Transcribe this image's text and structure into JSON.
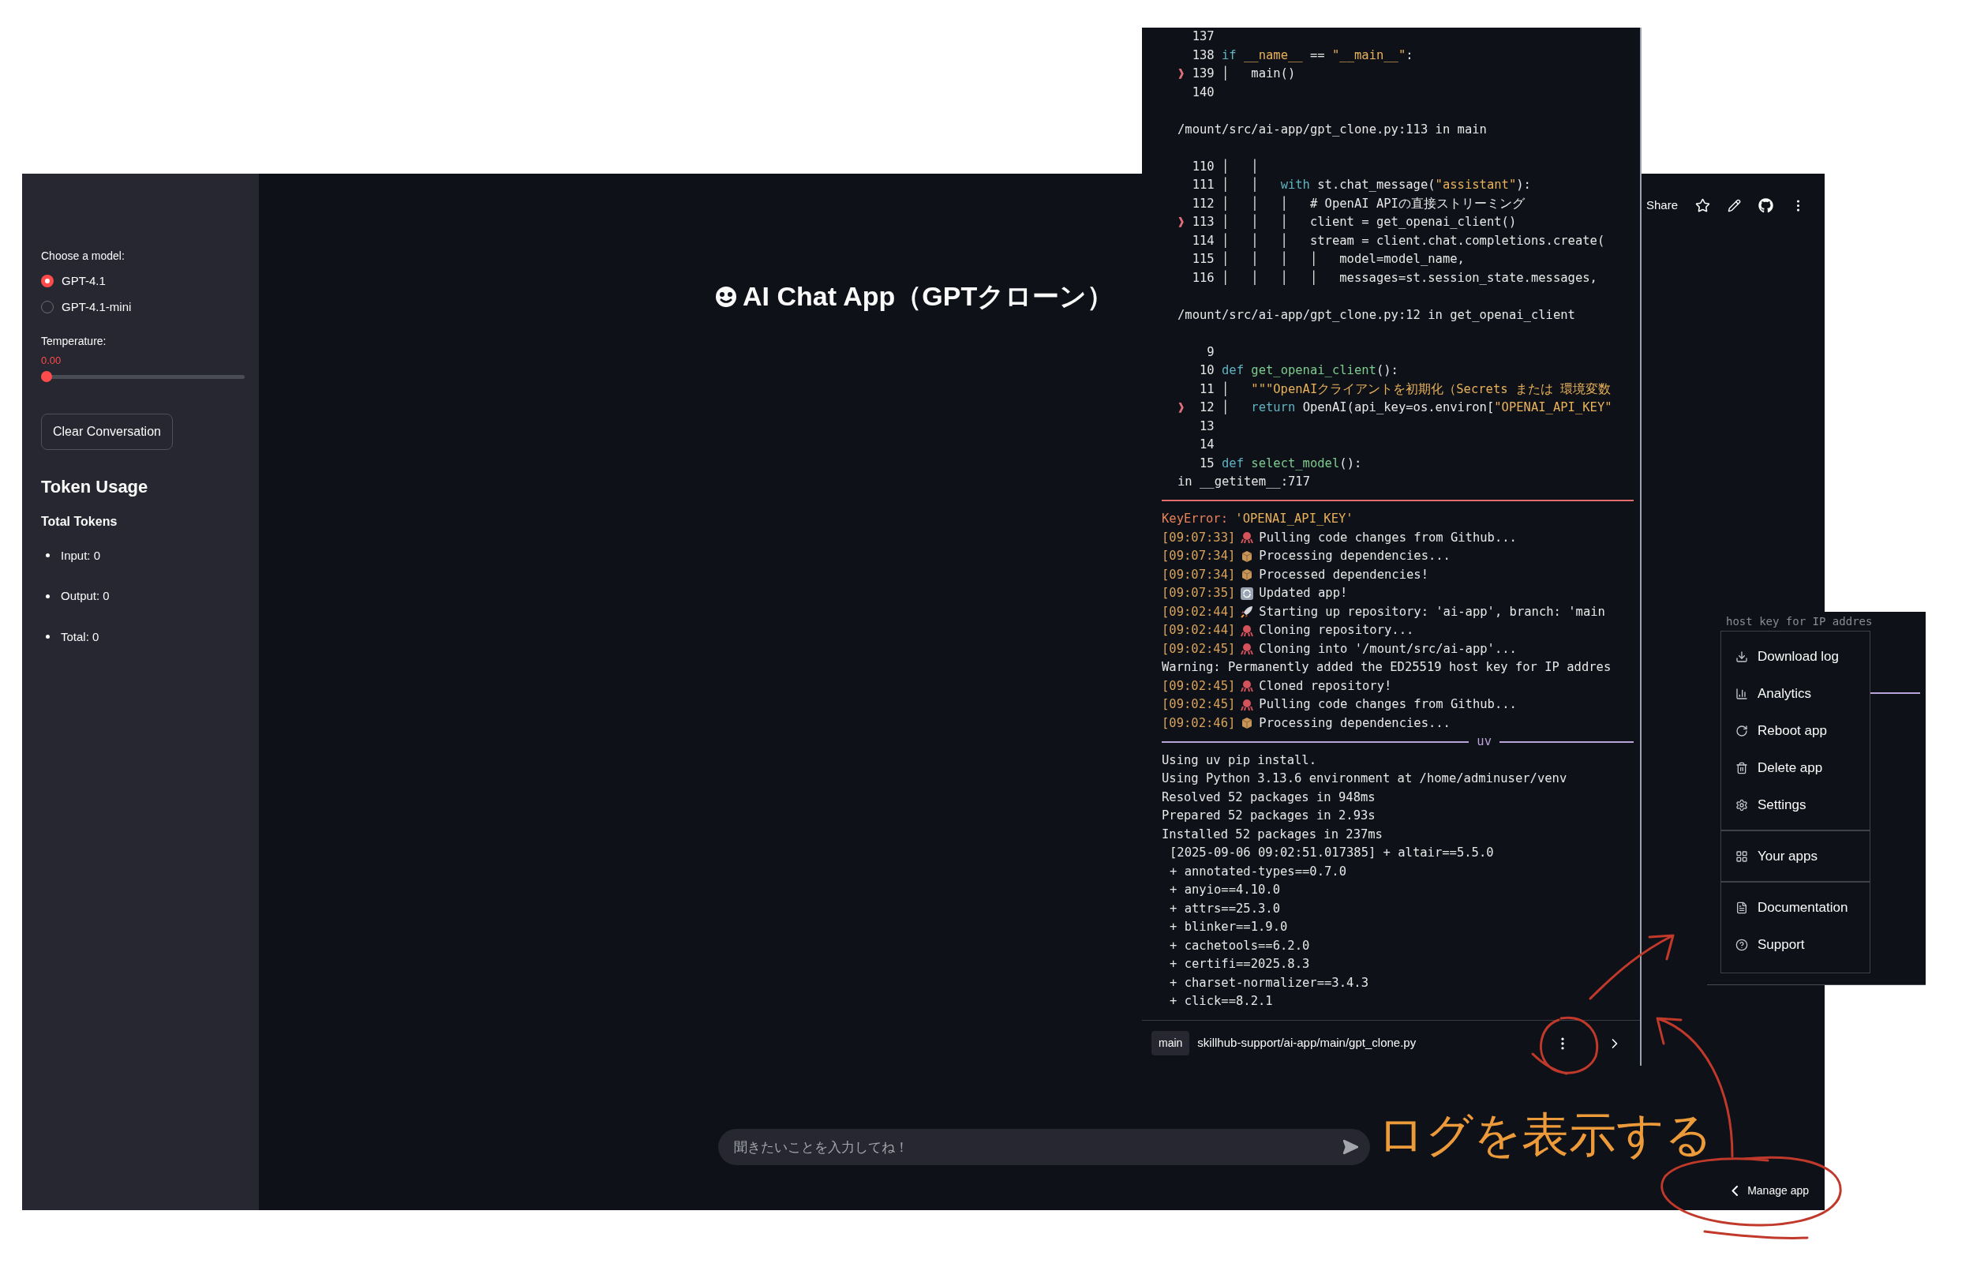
{
  "sidebar": {
    "model_label": "Choose a model:",
    "models": [
      {
        "label": "GPT-4.1",
        "selected": true
      },
      {
        "label": "GPT-4.1-mini",
        "selected": false
      }
    ],
    "temperature": {
      "label": "Temperature:",
      "value": "0.00",
      "level": 0
    },
    "clear_button": "Clear Conversation",
    "token_usage": {
      "heading": "Token Usage",
      "subheading": "Total Tokens",
      "items": [
        "Input: 0",
        "Output: 0",
        "Total: 0"
      ]
    }
  },
  "toolbar": {
    "share": "Share"
  },
  "title": "AI Chat App（GPTクローン）",
  "chat_input": {
    "placeholder": "聞きたいことを入力してね！"
  },
  "manage_app": "Manage app",
  "log_panel": {
    "lines": [
      {
        "kind": "code",
        "num": "137"
      },
      {
        "kind": "code",
        "num": "138",
        "tokens": [
          {
            "kind": "kw",
            "t": "if"
          },
          {
            "kind": "str",
            "t": " __name__"
          },
          {
            "kind": "plain",
            "t": " == "
          },
          {
            "kind": "str",
            "t": "\"__main__\""
          },
          {
            "kind": "plain",
            "t": ":"
          }
        ]
      },
      {
        "kind": "code",
        "marker": "❱",
        "num": "139",
        "tokens": [
          {
            "kind": "plain",
            "t": "│   main()"
          }
        ]
      },
      {
        "kind": "code",
        "num": "140"
      },
      {
        "kind": "blank"
      },
      {
        "kind": "path",
        "text": "/mount/src/ai-app/gpt_clone.py:113 in main"
      },
      {
        "kind": "blank"
      },
      {
        "kind": "code",
        "num": "110",
        "tokens": [
          {
            "kind": "plain",
            "t": "│   │"
          }
        ]
      },
      {
        "kind": "code",
        "num": "111",
        "tokens": [
          {
            "kind": "plain",
            "t": "│   │   "
          },
          {
            "kind": "kw",
            "t": "with"
          },
          {
            "kind": "plain",
            "t": " st.chat_message("
          },
          {
            "kind": "str",
            "t": "\"assistant\""
          },
          {
            "kind": "plain",
            "t": "):"
          }
        ]
      },
      {
        "kind": "code",
        "num": "112",
        "tokens": [
          {
            "kind": "plain",
            "t": "│   │   │   # OpenAI APIの直接ストリーミング"
          }
        ]
      },
      {
        "kind": "code",
        "marker": "❱",
        "num": "113",
        "tokens": [
          {
            "kind": "plain",
            "t": "│   │   │   client = get_openai_client()"
          }
        ]
      },
      {
        "kind": "code",
        "num": "114",
        "tokens": [
          {
            "kind": "plain",
            "t": "│   │   │   stream = client.chat.completions.create("
          }
        ]
      },
      {
        "kind": "code",
        "num": "115",
        "tokens": [
          {
            "kind": "plain",
            "t": "│   │   │   │   model=model_name,"
          }
        ]
      },
      {
        "kind": "code",
        "num": "116",
        "tokens": [
          {
            "kind": "plain",
            "t": "│   │   │   │   messages=st.session_state.messages,"
          }
        ]
      },
      {
        "kind": "blank"
      },
      {
        "kind": "path",
        "text": "/mount/src/ai-app/gpt_clone.py:12 in get_openai_client"
      },
      {
        "kind": "blank"
      },
      {
        "kind": "code",
        "num": "9"
      },
      {
        "kind": "code",
        "num": "10",
        "tokens": [
          {
            "kind": "kw",
            "t": "def"
          },
          {
            "kind": "fn",
            "t": " get_openai_client"
          },
          {
            "kind": "plain",
            "t": "():"
          }
        ]
      },
      {
        "kind": "code",
        "num": "11",
        "tokens": [
          {
            "kind": "plain",
            "t": "│   "
          },
          {
            "kind": "str",
            "t": "\"\"\"OpenAIクライアントを初期化（Secrets または 環境変数"
          }
        ]
      },
      {
        "kind": "code",
        "marker": "❱",
        "num": "12",
        "tokens": [
          {
            "kind": "plain",
            "t": "│   "
          },
          {
            "kind": "kw",
            "t": "return"
          },
          {
            "kind": "plain",
            "t": " OpenAI(api_key=os.environ["
          },
          {
            "kind": "str",
            "t": "\"OPENAI_API_KEY\""
          }
        ]
      },
      {
        "kind": "code",
        "num": "13"
      },
      {
        "kind": "code",
        "num": "14"
      },
      {
        "kind": "code",
        "num": "15",
        "tokens": [
          {
            "kind": "kw",
            "t": "def"
          },
          {
            "kind": "fn",
            "t": " select_model"
          },
          {
            "kind": "plain",
            "t": "():"
          }
        ]
      },
      {
        "kind": "path",
        "text": "in __getitem__:717"
      },
      {
        "kind": "rule"
      },
      {
        "kind": "error",
        "name": "KeyError:",
        "value": "'OPENAI_API_KEY'"
      },
      {
        "kind": "clone",
        "time": "[09:07:33]",
        "text": "Pulling code changes from Github..."
      },
      {
        "kind": "deps",
        "time": "[09:07:34]",
        "text": "Processing dependencies..."
      },
      {
        "kind": "deps",
        "time": "[09:07:34]",
        "text": "Processed dependencies!"
      },
      {
        "kind": "update",
        "time": "[09:07:35]",
        "text": "Updated app!"
      },
      {
        "kind": "start",
        "time": "[09:02:44]",
        "text": "Starting up repository: 'ai-app', branch: 'main"
      },
      {
        "kind": "clone",
        "time": "[09:02:44]",
        "text": "Cloning repository..."
      },
      {
        "kind": "clone",
        "time": "[09:02:45]",
        "text": "Cloning into '/mount/src/ai-app'..."
      },
      {
        "kind": "plain",
        "text": "Warning: Permanently added the ED25519 host key for IP addres"
      },
      {
        "kind": "clone",
        "time": "[09:02:45]",
        "text": "Cloned repository!"
      },
      {
        "kind": "clone",
        "time": "[09:02:45]",
        "text": "Pulling code changes from Github..."
      },
      {
        "kind": "deps",
        "time": "[09:02:46]",
        "text": "Processing dependencies..."
      },
      {
        "kind": "section",
        "text": "uv"
      },
      {
        "kind": "plain",
        "text": "Using uv pip install."
      },
      {
        "kind": "plain",
        "text": "Using Python 3.13.6 environment at /home/adminuser/venv"
      },
      {
        "kind": "plain",
        "text": "Resolved 52 packages in 948ms"
      },
      {
        "kind": "plain",
        "text": "Prepared 52 packages in 2.93s"
      },
      {
        "kind": "plain",
        "text": "Installed 52 packages in 237ms"
      },
      {
        "kind": "install",
        "text": "[2025-09-06 09:02:51.017385] + altair==5.5.0"
      },
      {
        "kind": "install",
        "text": "+ annotated-types==0.7.0"
      },
      {
        "kind": "install",
        "text": "+ anyio==4.10.0"
      },
      {
        "kind": "install",
        "text": "+ attrs==25.3.0"
      },
      {
        "kind": "install",
        "text": "+ blinker==1.9.0"
      },
      {
        "kind": "install",
        "text": "+ cachetools==6.2.0"
      },
      {
        "kind": "install",
        "text": "+ certifi==2025.8.3"
      },
      {
        "kind": "install",
        "text": "+ charset-normalizer==3.4.3"
      },
      {
        "kind": "install",
        "text": "+ click==8.2.1"
      }
    ],
    "footer": {
      "branch": "main",
      "path": "skillhub-support/ai-app/main/gpt_clone.py"
    }
  },
  "menu": {
    "background_text": "host key for IP addres",
    "groups": [
      [
        "Download log",
        "Analytics",
        "Reboot app",
        "Delete app",
        "Settings"
      ],
      [
        "Your apps"
      ],
      [
        "Documentation",
        "Support"
      ]
    ]
  },
  "annotation": {
    "text": "ログを表示する"
  }
}
